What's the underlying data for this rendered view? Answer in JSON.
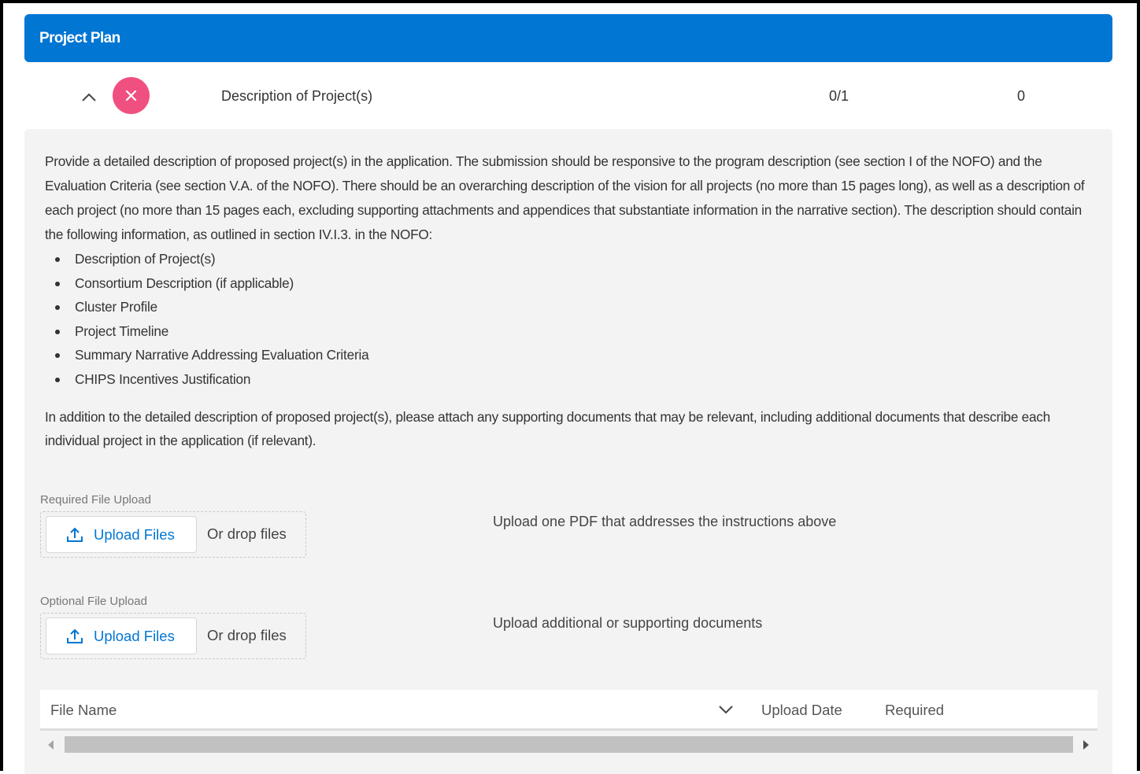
{
  "header": {
    "title": "Project Plan"
  },
  "row": {
    "label": "Description of Project(s)",
    "count": "0/1",
    "number": "0",
    "colors": {
      "close_button": "#f0507f"
    }
  },
  "description": {
    "paragraph": "Provide a detailed description of proposed project(s) in the application. The submission should be responsive to the program description (see section I of the NOFO) and the Evaluation Criteria (see section V.A. of the NOFO). There should be an overarching description of the vision for all projects (no more than 15 pages long), as well as a description of each project (no more than 15 pages each, excluding supporting attachments and appendices that substantiate information in the narrative section). The description should contain the following information, as outlined in section IV.I.3. in the NOFO:",
    "bullets": [
      "Description of Project(s)",
      "Consortium Description (if applicable)",
      "Cluster Profile",
      "Project Timeline",
      "Summary Narrative Addressing Evaluation Criteria",
      "CHIPS Incentives Justification"
    ],
    "additional": "In addition to the detailed description of proposed project(s), please attach any supporting documents that may be relevant, including additional documents that describe each individual project in the application (if relevant)."
  },
  "required_upload": {
    "label": "Required File Upload",
    "button": "Upload Files",
    "drop_text": "Or drop files",
    "hint": "Upload one PDF that addresses the instructions above"
  },
  "optional_upload": {
    "label": "Optional File Upload",
    "button": "Upload Files",
    "drop_text": "Or drop files",
    "hint": "Upload additional or supporting documents"
  },
  "table": {
    "columns": [
      "File Name",
      "Upload Date",
      "Required"
    ]
  },
  "icons": {
    "collapse": "chevron-up-icon",
    "close": "close-icon",
    "upload": "upload-icon",
    "sort": "chevron-down-icon"
  },
  "theme": {
    "accent": "#0176d3",
    "panel_bg": "#f3f3f3"
  }
}
